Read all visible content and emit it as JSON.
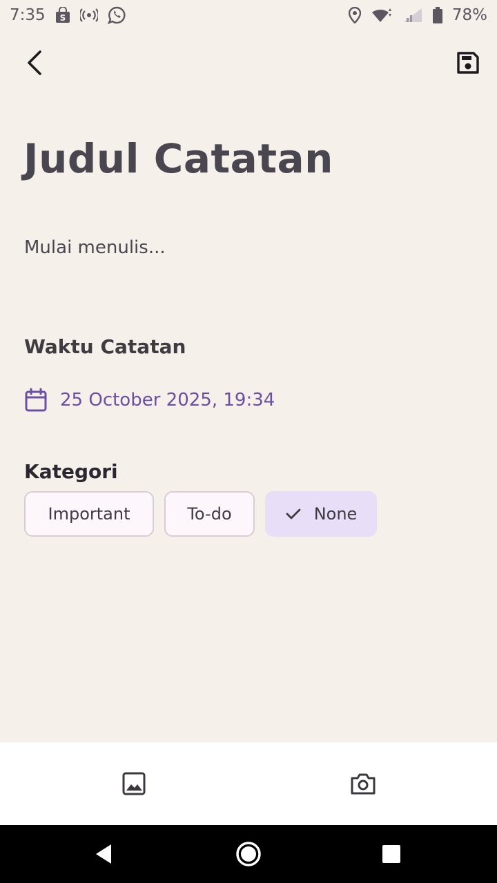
{
  "status_bar": {
    "time": "7:35",
    "battery": "78%",
    "icons_left": [
      "shopee-icon",
      "hotspot-icon",
      "whatsapp-icon"
    ],
    "icons_right": [
      "location-icon",
      "wifi-icon",
      "signal-icon",
      "battery-icon"
    ]
  },
  "app_bar": {
    "back_icon": "arrow-back-icon",
    "save_icon": "save-icon"
  },
  "note": {
    "title_placeholder": "Judul Catatan",
    "body_placeholder": "Mulai menulis..."
  },
  "time_section": {
    "title": "Waktu Catatan",
    "date_value": "25 October 2025, 19:34",
    "icon": "calendar-icon"
  },
  "category_section": {
    "title": "Kategori",
    "chips": [
      {
        "label": "Important",
        "selected": false
      },
      {
        "label": "To-do",
        "selected": false
      },
      {
        "label": "None",
        "selected": true
      }
    ]
  },
  "bottom_bar": {
    "icons": [
      "image-icon",
      "camera-icon"
    ]
  },
  "nav_bar": {
    "icons": [
      "nav-back-icon",
      "nav-home-icon",
      "nav-recent-icon"
    ]
  },
  "colors": {
    "background": "#f5f0e9",
    "accent": "#6a4fa3",
    "chip_selected": "#e8def7",
    "chip_default": "#fdf7fb"
  }
}
